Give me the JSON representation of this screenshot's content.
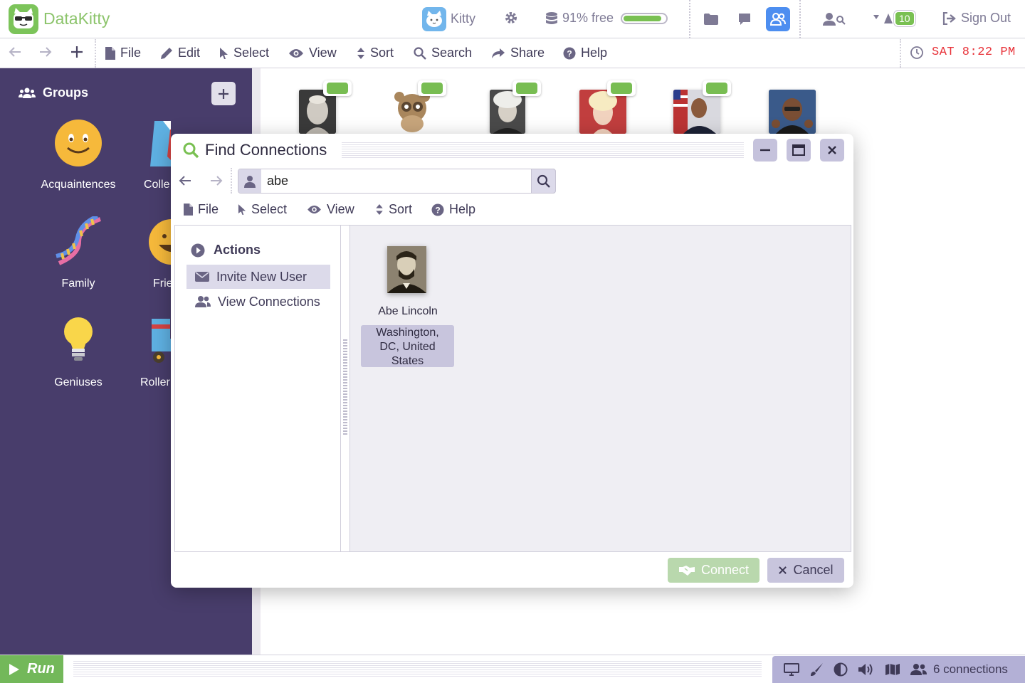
{
  "app": {
    "name": "DataKitty"
  },
  "topbar": {
    "username": "Kitty",
    "storage_label": "91% free",
    "storage_fraction": 0.91,
    "notifications_count": "10",
    "signout_label": "Sign Out"
  },
  "menubar": {
    "items": [
      "File",
      "Edit",
      "Select",
      "View",
      "Sort",
      "Search",
      "Share",
      "Help"
    ],
    "clock": "SAT 8:22 PM"
  },
  "sidebar": {
    "title": "Groups",
    "groups": [
      "Acquaintences",
      "Colle",
      "Family",
      "Frie",
      "Geniuses",
      "Roller"
    ]
  },
  "bottombar": {
    "run_label": "Run",
    "connections_label": "6 connections"
  },
  "dialog": {
    "title": "Find Connections",
    "search": {
      "value": "abe"
    },
    "menu": [
      "File",
      "Select",
      "View",
      "Sort",
      "Help"
    ],
    "actions_title": "Actions",
    "actions": [
      "Invite New User",
      "View Connections"
    ],
    "result": {
      "name": "Abe Lincoln",
      "location": "Washington, DC, United States"
    },
    "buttons": {
      "connect": "Connect",
      "cancel": "Cancel"
    }
  },
  "colors": {
    "brand_green": "#7cc45a",
    "sidebar_purple": "#483d6b",
    "accent_blue": "#4d8ef0",
    "clock_red": "#e8333a"
  },
  "icons": [
    "app-logo-icon",
    "user-avatar-icon",
    "gear-icon",
    "database-icon",
    "folder-icon",
    "chat-icon",
    "people-icon",
    "user-search-icon",
    "notification-icon",
    "sign-out-icon",
    "back-arrow-icon",
    "forward-arrow-icon",
    "plus-icon",
    "file-icon",
    "pencil-icon",
    "cursor-icon",
    "eye-icon",
    "sort-icon",
    "search-icon",
    "share-icon",
    "help-icon",
    "clock-icon",
    "groups-icon",
    "play-icon",
    "monitor-icon",
    "brush-icon",
    "contrast-icon",
    "volume-icon",
    "map-icon"
  ]
}
